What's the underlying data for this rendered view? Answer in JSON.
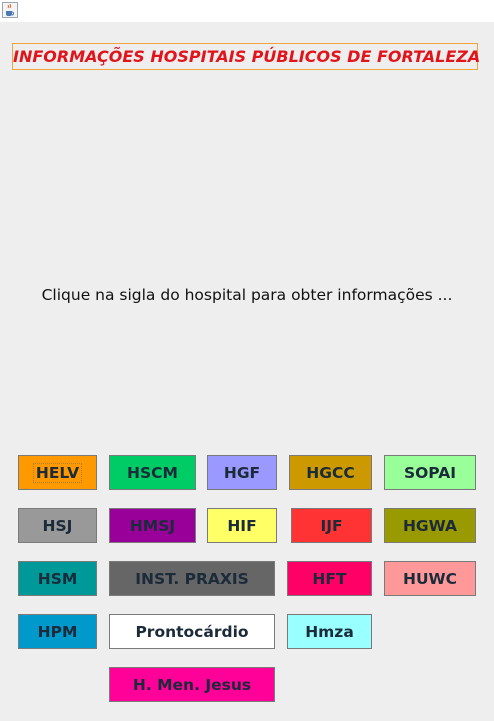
{
  "window": {
    "icon": "java-cup-icon"
  },
  "header": {
    "title": "INFORMAÇÕES HOSPITAIS PÚBLICOS DE FORTALEZA"
  },
  "instruction": "Clique na sigla do hospital para obter informações ...",
  "buttons": {
    "helv": {
      "label": "HELV",
      "color": "#ff9900"
    },
    "hscm": {
      "label": "HSCM",
      "color": "#00cc66"
    },
    "hgf": {
      "label": "HGF",
      "color": "#9999ff"
    },
    "hgcc": {
      "label": "HGCC",
      "color": "#cc9900"
    },
    "sopai": {
      "label": "SOPAI",
      "color": "#99ff99"
    },
    "hsj": {
      "label": "HSJ",
      "color": "#999999"
    },
    "hmsj": {
      "label": "HMSJ",
      "color": "#990099"
    },
    "hif": {
      "label": "HIF",
      "color": "#ffff66"
    },
    "ijf": {
      "label": "IJF",
      "color": "#ff3333"
    },
    "hgwa": {
      "label": "HGWA",
      "color": "#999900"
    },
    "hsm": {
      "label": "HSM",
      "color": "#009999"
    },
    "inst_praxis": {
      "label": "INST. PRAXIS",
      "color": "#666666"
    },
    "hft": {
      "label": "HFT",
      "color": "#ff0066"
    },
    "huwc": {
      "label": "HUWC",
      "color": "#ff9999"
    },
    "hpm": {
      "label": "HPM",
      "color": "#0099cc"
    },
    "prontocardio": {
      "label": "Prontocárdio",
      "color": "#ffffff"
    },
    "hmza": {
      "label": "Hmza",
      "color": "#99ffff"
    },
    "h_men_jesus": {
      "label": "H. Men. Jesus",
      "color": "#ff0099"
    }
  }
}
